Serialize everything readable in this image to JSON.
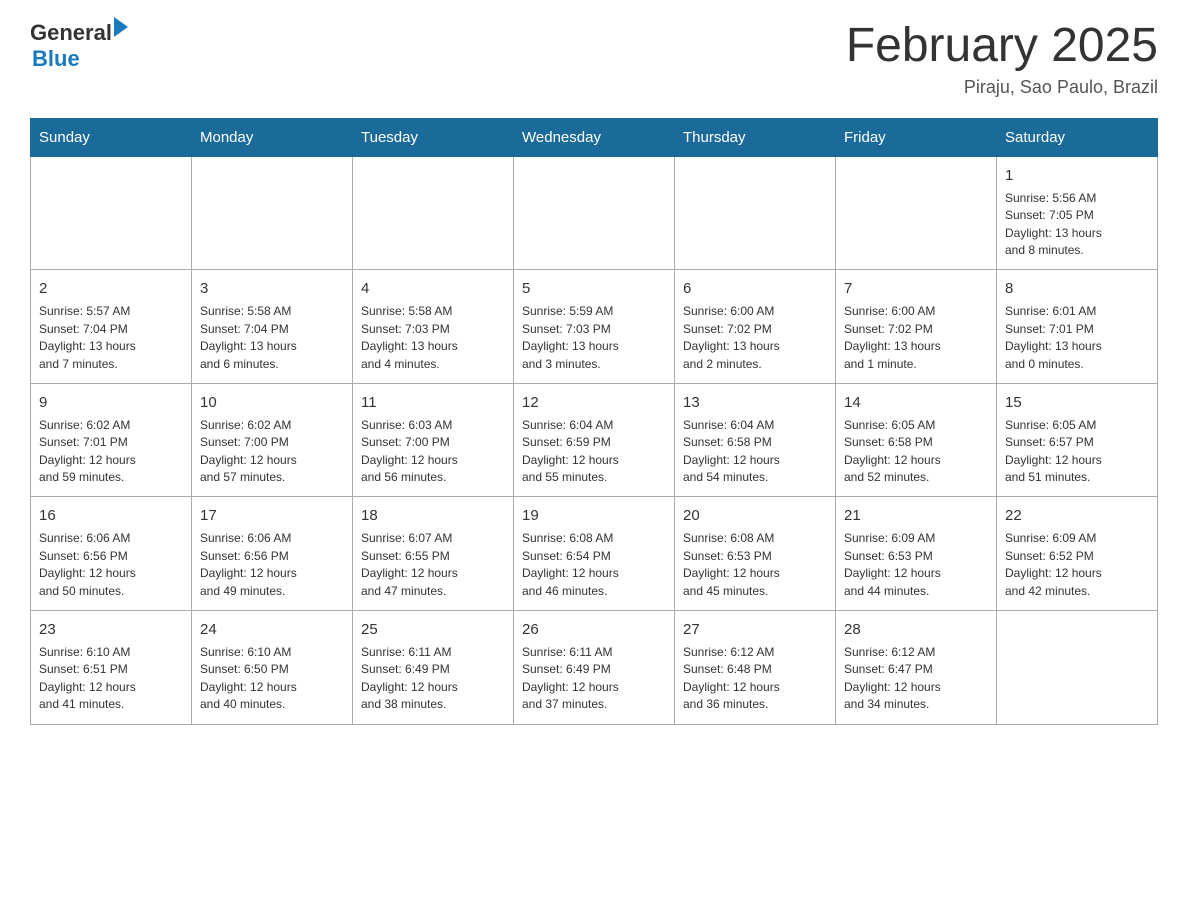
{
  "header": {
    "logo_general": "General",
    "logo_blue": "Blue",
    "month_title": "February 2025",
    "location": "Piraju, Sao Paulo, Brazil"
  },
  "weekdays": [
    "Sunday",
    "Monday",
    "Tuesday",
    "Wednesday",
    "Thursday",
    "Friday",
    "Saturday"
  ],
  "weeks": [
    [
      {
        "day": "",
        "info": ""
      },
      {
        "day": "",
        "info": ""
      },
      {
        "day": "",
        "info": ""
      },
      {
        "day": "",
        "info": ""
      },
      {
        "day": "",
        "info": ""
      },
      {
        "day": "",
        "info": ""
      },
      {
        "day": "1",
        "info": "Sunrise: 5:56 AM\nSunset: 7:05 PM\nDaylight: 13 hours\nand 8 minutes."
      }
    ],
    [
      {
        "day": "2",
        "info": "Sunrise: 5:57 AM\nSunset: 7:04 PM\nDaylight: 13 hours\nand 7 minutes."
      },
      {
        "day": "3",
        "info": "Sunrise: 5:58 AM\nSunset: 7:04 PM\nDaylight: 13 hours\nand 6 minutes."
      },
      {
        "day": "4",
        "info": "Sunrise: 5:58 AM\nSunset: 7:03 PM\nDaylight: 13 hours\nand 4 minutes."
      },
      {
        "day": "5",
        "info": "Sunrise: 5:59 AM\nSunset: 7:03 PM\nDaylight: 13 hours\nand 3 minutes."
      },
      {
        "day": "6",
        "info": "Sunrise: 6:00 AM\nSunset: 7:02 PM\nDaylight: 13 hours\nand 2 minutes."
      },
      {
        "day": "7",
        "info": "Sunrise: 6:00 AM\nSunset: 7:02 PM\nDaylight: 13 hours\nand 1 minute."
      },
      {
        "day": "8",
        "info": "Sunrise: 6:01 AM\nSunset: 7:01 PM\nDaylight: 13 hours\nand 0 minutes."
      }
    ],
    [
      {
        "day": "9",
        "info": "Sunrise: 6:02 AM\nSunset: 7:01 PM\nDaylight: 12 hours\nand 59 minutes."
      },
      {
        "day": "10",
        "info": "Sunrise: 6:02 AM\nSunset: 7:00 PM\nDaylight: 12 hours\nand 57 minutes."
      },
      {
        "day": "11",
        "info": "Sunrise: 6:03 AM\nSunset: 7:00 PM\nDaylight: 12 hours\nand 56 minutes."
      },
      {
        "day": "12",
        "info": "Sunrise: 6:04 AM\nSunset: 6:59 PM\nDaylight: 12 hours\nand 55 minutes."
      },
      {
        "day": "13",
        "info": "Sunrise: 6:04 AM\nSunset: 6:58 PM\nDaylight: 12 hours\nand 54 minutes."
      },
      {
        "day": "14",
        "info": "Sunrise: 6:05 AM\nSunset: 6:58 PM\nDaylight: 12 hours\nand 52 minutes."
      },
      {
        "day": "15",
        "info": "Sunrise: 6:05 AM\nSunset: 6:57 PM\nDaylight: 12 hours\nand 51 minutes."
      }
    ],
    [
      {
        "day": "16",
        "info": "Sunrise: 6:06 AM\nSunset: 6:56 PM\nDaylight: 12 hours\nand 50 minutes."
      },
      {
        "day": "17",
        "info": "Sunrise: 6:06 AM\nSunset: 6:56 PM\nDaylight: 12 hours\nand 49 minutes."
      },
      {
        "day": "18",
        "info": "Sunrise: 6:07 AM\nSunset: 6:55 PM\nDaylight: 12 hours\nand 47 minutes."
      },
      {
        "day": "19",
        "info": "Sunrise: 6:08 AM\nSunset: 6:54 PM\nDaylight: 12 hours\nand 46 minutes."
      },
      {
        "day": "20",
        "info": "Sunrise: 6:08 AM\nSunset: 6:53 PM\nDaylight: 12 hours\nand 45 minutes."
      },
      {
        "day": "21",
        "info": "Sunrise: 6:09 AM\nSunset: 6:53 PM\nDaylight: 12 hours\nand 44 minutes."
      },
      {
        "day": "22",
        "info": "Sunrise: 6:09 AM\nSunset: 6:52 PM\nDaylight: 12 hours\nand 42 minutes."
      }
    ],
    [
      {
        "day": "23",
        "info": "Sunrise: 6:10 AM\nSunset: 6:51 PM\nDaylight: 12 hours\nand 41 minutes."
      },
      {
        "day": "24",
        "info": "Sunrise: 6:10 AM\nSunset: 6:50 PM\nDaylight: 12 hours\nand 40 minutes."
      },
      {
        "day": "25",
        "info": "Sunrise: 6:11 AM\nSunset: 6:49 PM\nDaylight: 12 hours\nand 38 minutes."
      },
      {
        "day": "26",
        "info": "Sunrise: 6:11 AM\nSunset: 6:49 PM\nDaylight: 12 hours\nand 37 minutes."
      },
      {
        "day": "27",
        "info": "Sunrise: 6:12 AM\nSunset: 6:48 PM\nDaylight: 12 hours\nand 36 minutes."
      },
      {
        "day": "28",
        "info": "Sunrise: 6:12 AM\nSunset: 6:47 PM\nDaylight: 12 hours\nand 34 minutes."
      },
      {
        "day": "",
        "info": ""
      }
    ]
  ]
}
